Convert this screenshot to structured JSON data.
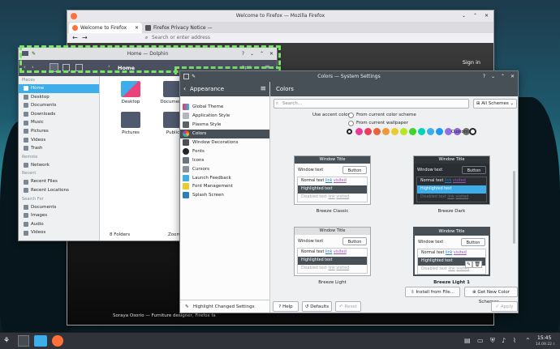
{
  "firefox": {
    "title": "Welcome to Firefox — Mozilla Firefox",
    "tab1": "Welcome to Firefox",
    "tab2": "Firefox Privacy Notice —",
    "search_placeholder": "Search or enter address",
    "signin": "Sign in",
    "caption": "Soraya Osorio — Furniture designer, Firefox fa"
  },
  "dolphin": {
    "title": "Home — Dolphin",
    "location": "Home",
    "split": "Split",
    "sections": [
      {
        "label": "Places",
        "items": [
          "Home",
          "Desktop",
          "Documents",
          "Downloads",
          "Music",
          "Pictures",
          "Videos",
          "Trash"
        ]
      },
      {
        "label": "Remote",
        "items": [
          "Network"
        ]
      },
      {
        "label": "Recent",
        "items": [
          "Recent Files",
          "Recent Locations"
        ]
      },
      {
        "label": "Search For",
        "items": [
          "Documents",
          "Images",
          "Audio",
          "Videos"
        ]
      }
    ],
    "folders": [
      "Desktop",
      "Documents",
      "Pictures",
      "Public"
    ],
    "status": "8 Folders",
    "zoom": "Zoom"
  },
  "settings": {
    "title": "Colors — System Settings",
    "sidebar_title": "Appearance",
    "page_title": "Colors",
    "sidebar_items": [
      "Global Theme",
      "Application Style",
      "Plasma Style",
      "Colors",
      "Window Decorations",
      "Fonts",
      "Icons",
      "Cursors",
      "Launch Feedback",
      "Font Management",
      "Splash Screen"
    ],
    "highlight_changed": "Highlight Changed Settings",
    "search_placeholder": "Search...",
    "filter": "All Schemes",
    "accent_label": "Use accent color:",
    "accent_options": [
      "From current color scheme",
      "From current wallpaper"
    ],
    "custom": "Custom",
    "accent_colors": [
      "#e93a9a",
      "#e93d58",
      "#e9643a",
      "#ef973c",
      "#e8cb2d",
      "#b6e521",
      "#3dd425",
      "#00d3b8",
      "#3daee9",
      "#1d99f3",
      "#926ee4",
      "#8e64e0",
      "#6d6d6d"
    ],
    "schemes": [
      {
        "name": "Breeze Classic",
        "title": "Window Title",
        "window_text": "Window text",
        "button": "Button",
        "normal": "Normal text",
        "link": "link",
        "visited": "visited",
        "highlighted": "Highlighted text",
        "disabled": "Disabled text"
      },
      {
        "name": "Breeze Dark",
        "title": "Window Title",
        "window_text": "Window text",
        "button": "Button",
        "normal": "Normal text",
        "link": "link",
        "visited": "visited",
        "highlighted": "Highlighted text",
        "disabled": "Disabled text"
      },
      {
        "name": "Breeze Light",
        "title": "Window Title",
        "window_text": "Window text",
        "button": "Button",
        "normal": "Normal text",
        "link": "link",
        "visited": "visited",
        "highlighted": "Highlighted text",
        "disabled": "Disabled text"
      },
      {
        "name": "Breeze Light 1",
        "title": "Window Title",
        "window_text": "Window text",
        "button": "Button",
        "normal": "Normal text",
        "link": "link",
        "visited": "visited",
        "highlighted": "Highlighted text",
        "disabled": "Disabled text"
      }
    ],
    "install": "Install from File...",
    "get_new": "Get New Color Schemes...",
    "help": "Help",
    "defaults": "Defaults",
    "reset": "Reset",
    "apply": "Apply"
  },
  "panel": {
    "time": "15:45",
    "date": "14.09.22 r."
  }
}
